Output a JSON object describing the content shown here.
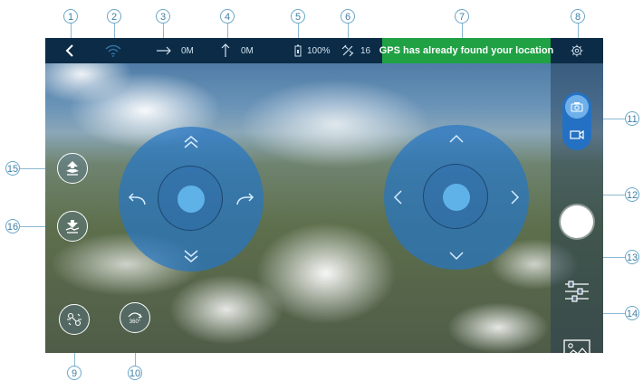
{
  "callouts": {
    "n1": "1",
    "n2": "2",
    "n3": "3",
    "n4": "4",
    "n5": "5",
    "n6": "6",
    "n7": "7",
    "n8": "8",
    "n9": "9",
    "n10": "10",
    "n11": "11",
    "n12": "12",
    "n13": "13",
    "n14": "14",
    "n15": "15",
    "n16": "16"
  },
  "topbar": {
    "horizontal_distance": "0M",
    "altitude": "0M",
    "battery": "100%",
    "satellites": "16",
    "gps_status": "GPS has already found your location"
  },
  "icons": {
    "back": "back-chevron-icon",
    "wifi": "wifi-icon",
    "distance": "arrow-right-icon",
    "altitude": "arrow-up-icon",
    "battery": "battery-icon",
    "satellite": "satellite-icon",
    "settings": "gear-icon",
    "camera": "camera-icon",
    "video": "video-camera-icon",
    "shutter": "shutter-button",
    "calibrate": "sliders-icon",
    "gallery": "gallery-icon",
    "takeoff": "takeoff-icon",
    "land": "landing-icon",
    "headless": "headless-mode-icon",
    "flip": "flip-360-icon"
  },
  "colors": {
    "topbar": "#0b2b46",
    "gps_banner": "#1fa144",
    "joystick": "#2676c4",
    "callout": "#3e7fa5"
  }
}
